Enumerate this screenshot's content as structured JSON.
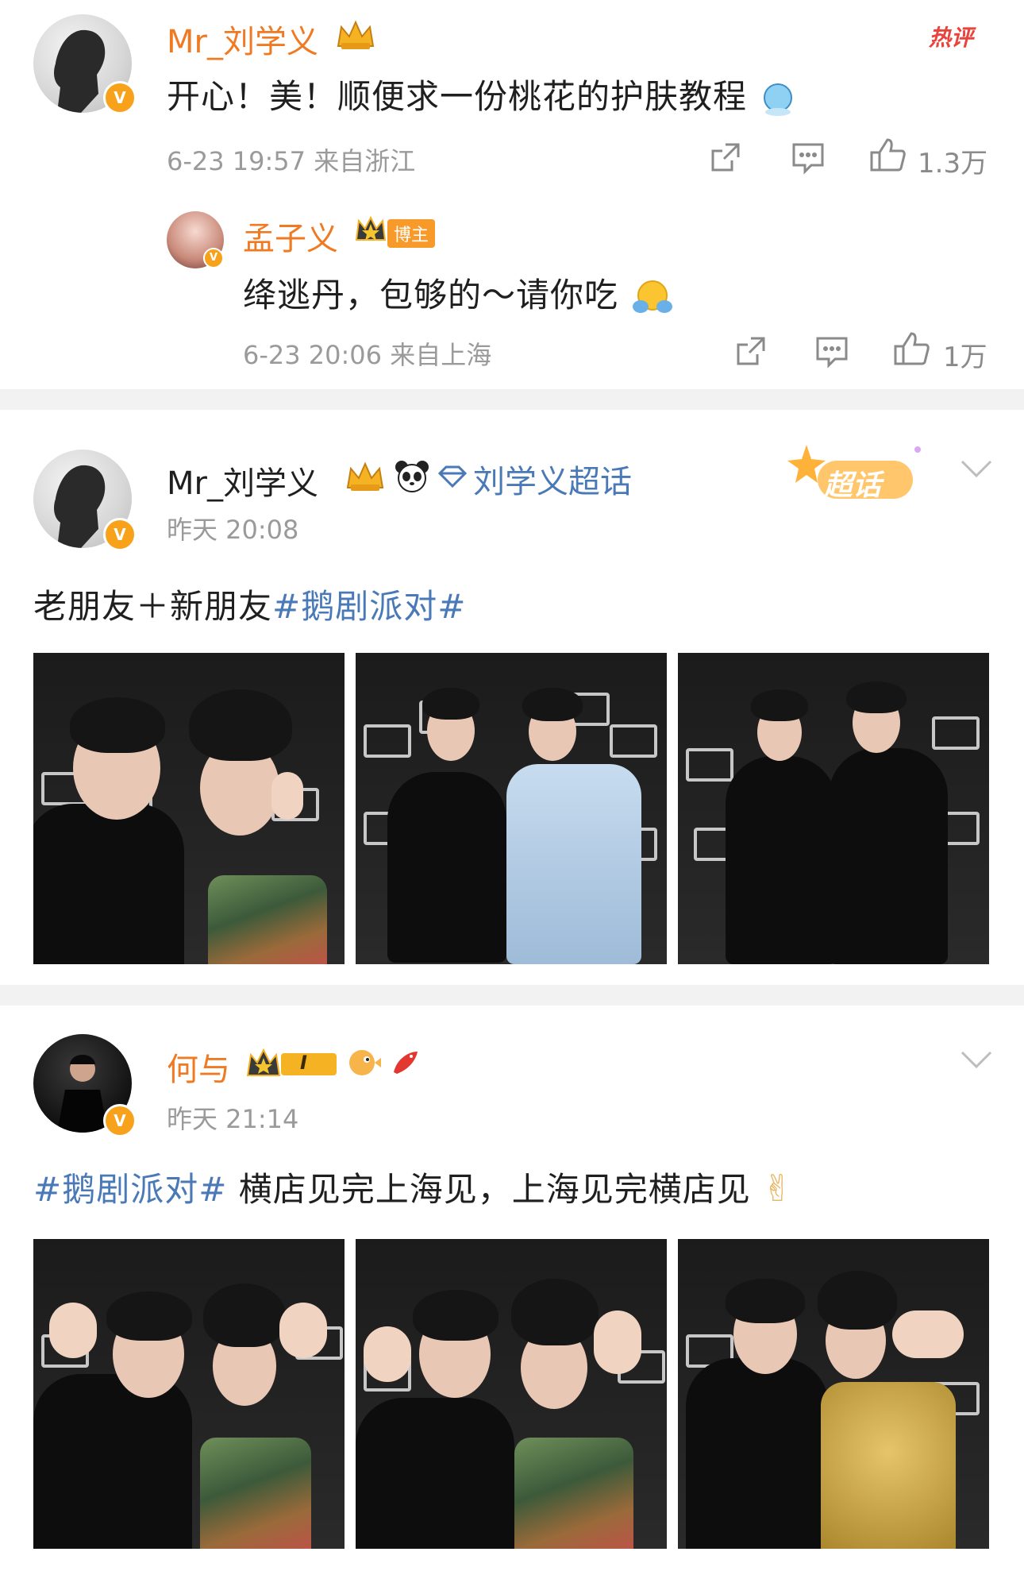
{
  "post1": {
    "hot_label": "热评",
    "author": "Mr_刘学义",
    "text": "开心！美！顺便求一份桃花的护肤教程",
    "time": "6-23 19:57 来自浙江",
    "likes": "1.3万",
    "reply": {
      "author": "孟子义",
      "badge": "博主",
      "text": "绛逃丹，包够的～请你吃",
      "time": "6-23 20:06 来自上海",
      "likes": "1万"
    }
  },
  "post2": {
    "author": "Mr_刘学义",
    "super_topic": "刘学义超话",
    "super_label": "超话",
    "time": "昨天 20:08",
    "text_plain": "老朋友＋新朋友",
    "hashtag": "#鹅剧派对#"
  },
  "post3": {
    "author": "何与",
    "level": "I",
    "time": "昨天 21:14",
    "hashtag": "#鹅剧派对#",
    "text_plain": " 横店见完上海见，上海见完横店见",
    "emoji": "✌"
  },
  "icons": {
    "share": "share-icon",
    "comment": "comment-icon",
    "like": "thumbs-up-icon",
    "more": "chevron-down-icon"
  },
  "colors": {
    "name_orange": "#f07a22",
    "hashtag_blue": "#4a79b8",
    "meta_gray": "#9a9a9a",
    "badge_orange": "#f7a21a"
  }
}
